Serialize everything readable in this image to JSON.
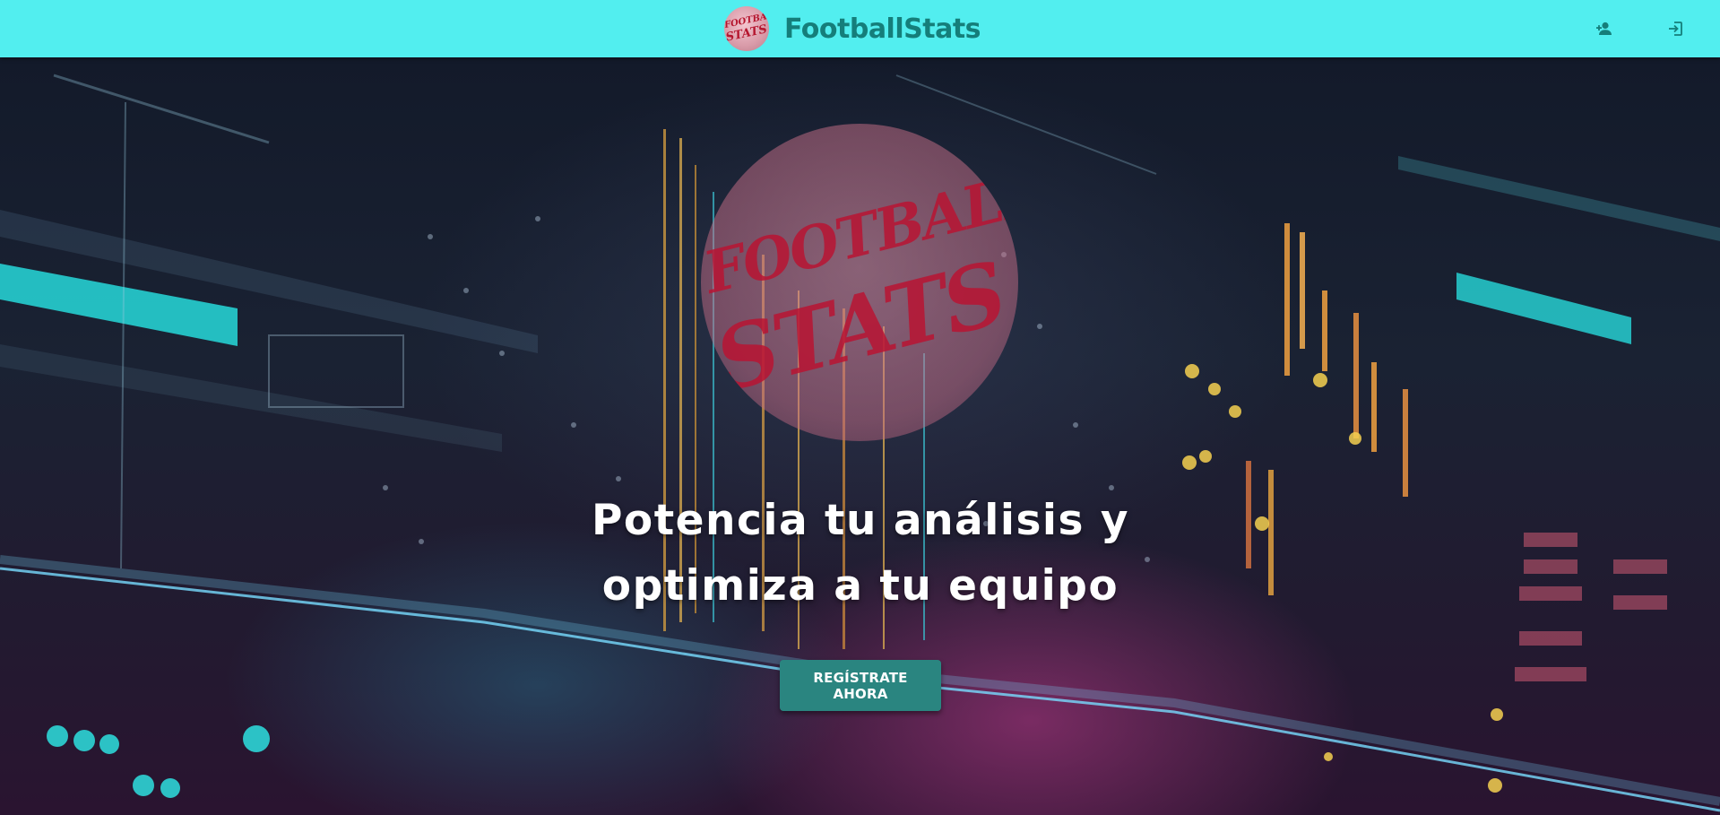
{
  "navbar": {
    "brand_logo_line1": "FOOTBALL",
    "brand_logo_line2": "STATS",
    "brand_title": "FootballStats",
    "background_color": "#52eeef",
    "title_color": "#157e7a",
    "icons": [
      "person-add-icon",
      "login-icon"
    ]
  },
  "hero": {
    "watermark_line1": "FOOTBALL",
    "watermark_line2": "STATS",
    "headline_line1": "Potencia tu análisis y",
    "headline_line2": "optimiza a tu equipo",
    "cta_label": "REGÍSTRATE AHORA",
    "cta_color": "#2a8580"
  }
}
